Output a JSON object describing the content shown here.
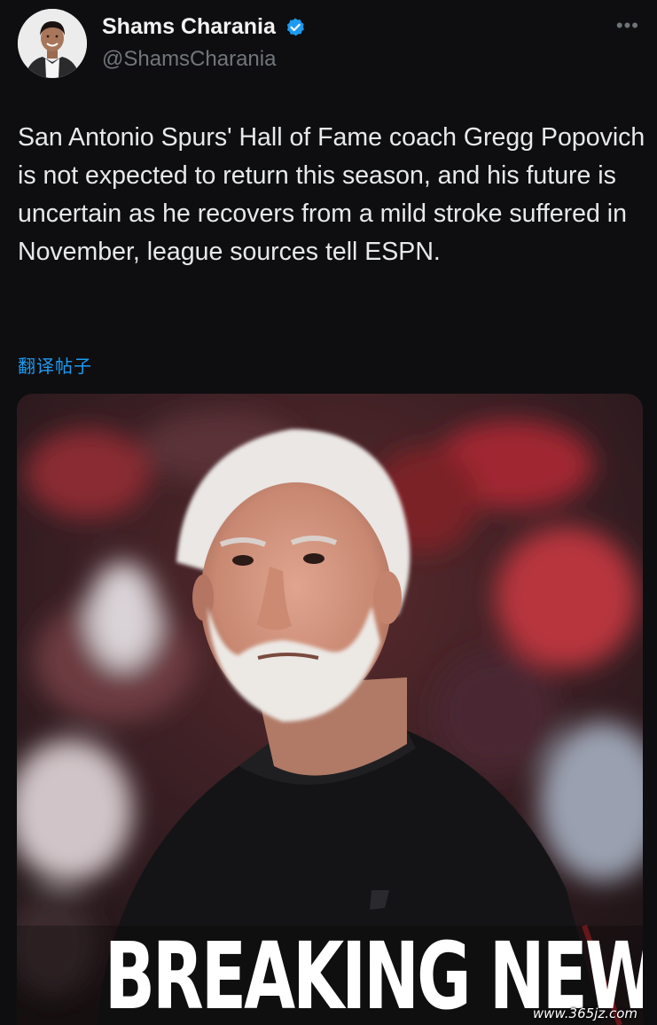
{
  "author": {
    "display_name": "Shams Charania",
    "handle": "@ShamsCharania",
    "verified": true,
    "verified_color": "#1d9bf0"
  },
  "menu": {
    "more_icon": "more-horizontal-icon"
  },
  "tweet": {
    "text": "San Antonio Spurs' Hall of Fame coach Gregg Popovich is not expected to return this season, and his future is uncertain as he recovers from a mild stroke suffered in November, league sources tell ESPN.",
    "translate_label": "翻译帖子"
  },
  "media": {
    "overlay_text": "BREAKING NEWS",
    "watermark": "www.365jz.com"
  },
  "colors": {
    "background": "#0e0e10",
    "link": "#1d9bf0",
    "secondary_text": "#71767b"
  }
}
